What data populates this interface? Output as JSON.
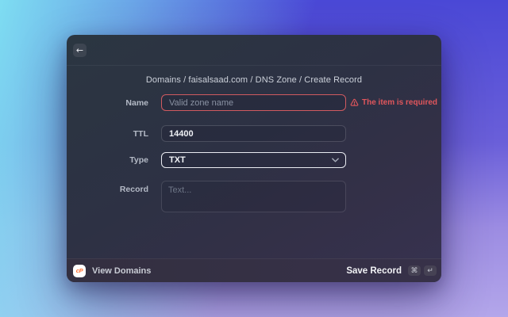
{
  "window": {
    "back_icon": "←"
  },
  "breadcrumb": "Domains / faisalsaad.com / DNS Zone / Create Record",
  "form": {
    "name": {
      "label": "Name",
      "value": "",
      "placeholder": "Valid zone name",
      "error": "The item is required"
    },
    "ttl": {
      "label": "TTL",
      "value": "14400"
    },
    "type": {
      "label": "Type",
      "value": "TXT"
    },
    "record": {
      "label": "Record",
      "value": "",
      "placeholder": "Text..."
    }
  },
  "footer": {
    "brand": "cP",
    "view_domains_label": "View Domains",
    "save_record_label": "Save Record",
    "shortcut_keys": [
      "⌘",
      "↵"
    ]
  },
  "colors": {
    "error": "#e0565c",
    "focus_border": "#e9ebf1",
    "brand_orange": "#ff6c2c",
    "bg_top_left": "#80e3f3",
    "bg_top_right": "#4a48d6",
    "bg_bottom": "#b3a6ea",
    "modal_bg": "#303047"
  }
}
